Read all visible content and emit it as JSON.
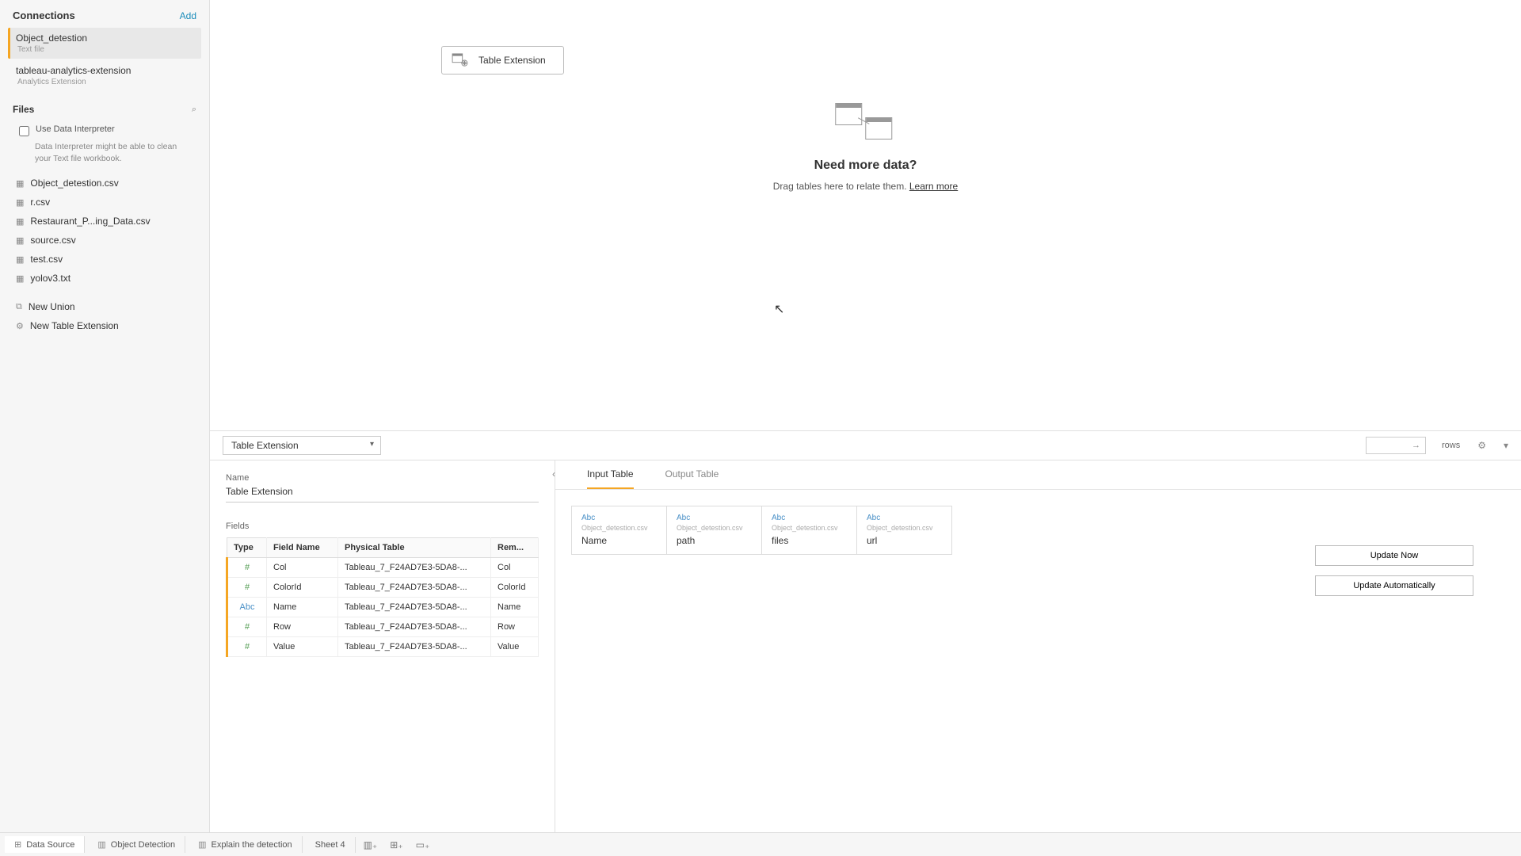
{
  "sidebar": {
    "connections_label": "Connections",
    "add_label": "Add",
    "connections": [
      {
        "name": "Object_detestion",
        "sub": "Text file",
        "active": true
      },
      {
        "name": "tableau-analytics-extension",
        "sub": "Analytics Extension",
        "active": false
      }
    ],
    "files_label": "Files",
    "interpreter_label": "Use Data Interpreter",
    "interpreter_hint": "Data Interpreter might be able to clean your Text file workbook.",
    "files": [
      "Object_detestion.csv",
      "r.csv",
      "Restaurant_P...ing_Data.csv",
      "source.csv",
      "test.csv",
      "yolov3.txt"
    ],
    "new_union": "New Union",
    "new_table_ext": "New Table Extension"
  },
  "canvas": {
    "pill_label": "Table Extension",
    "empty_title": "Need more data?",
    "empty_sub": "Drag tables here to relate them. ",
    "learn_more": "Learn more"
  },
  "detail": {
    "dropdown": "Table Extension",
    "rows_label": "rows",
    "name_label": "Name",
    "name_value": "Table Extension",
    "fields_label": "Fields",
    "field_headers": {
      "type": "Type",
      "fname": "Field Name",
      "ptable": "Physical Table",
      "remote": "Rem..."
    },
    "fields": [
      {
        "type": "#",
        "name": "Col",
        "ptable": "Tableau_7_F24AD7E3-5DA8-...",
        "remote": "Col"
      },
      {
        "type": "#",
        "name": "ColorId",
        "ptable": "Tableau_7_F24AD7E3-5DA8-...",
        "remote": "ColorId"
      },
      {
        "type": "Abc",
        "name": "Name",
        "ptable": "Tableau_7_F24AD7E3-5DA8-...",
        "remote": "Name"
      },
      {
        "type": "#",
        "name": "Row",
        "ptable": "Tableau_7_F24AD7E3-5DA8-...",
        "remote": "Row"
      },
      {
        "type": "#",
        "name": "Value",
        "ptable": "Tableau_7_F24AD7E3-5DA8-...",
        "remote": "Value"
      }
    ],
    "tab_input": "Input Table",
    "tab_output": "Output Table",
    "io_source": "Object_detestion.csv",
    "io_cols": [
      "Name",
      "path",
      "files",
      "url"
    ],
    "update_now": "Update Now",
    "update_auto": "Update Automatically"
  },
  "status": {
    "data_source": "Data Source",
    "tabs": [
      "Object Detection",
      "Explain the detection",
      "Sheet 4"
    ]
  }
}
